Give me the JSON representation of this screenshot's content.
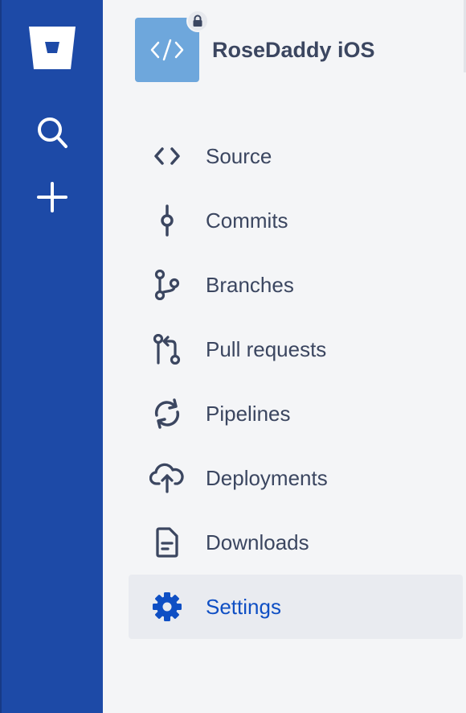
{
  "global_nav": {
    "logo_icon": "bitbucket-logo-icon",
    "search_icon": "search-icon",
    "create_icon": "plus-icon",
    "background": "#1d4aa7"
  },
  "repo": {
    "name": "RoseDaddy iOS",
    "avatar_icon": "code-icon",
    "private_icon": "lock-icon",
    "avatar_color": "#6ea7dc"
  },
  "nav": {
    "items": [
      {
        "label": "Source",
        "icon": "source-code-icon"
      },
      {
        "label": "Commits",
        "icon": "commit-icon"
      },
      {
        "label": "Branches",
        "icon": "branch-icon"
      },
      {
        "label": "Pull requests",
        "icon": "pull-request-icon"
      },
      {
        "label": "Pipelines",
        "icon": "pipelines-icon"
      },
      {
        "label": "Deployments",
        "icon": "cloud-upload-icon"
      },
      {
        "label": "Downloads",
        "icon": "document-icon"
      },
      {
        "label": "Settings",
        "icon": "gear-icon",
        "selected": true
      }
    ],
    "selected_color": "#0f4fc4",
    "text_color": "#3b4660"
  }
}
